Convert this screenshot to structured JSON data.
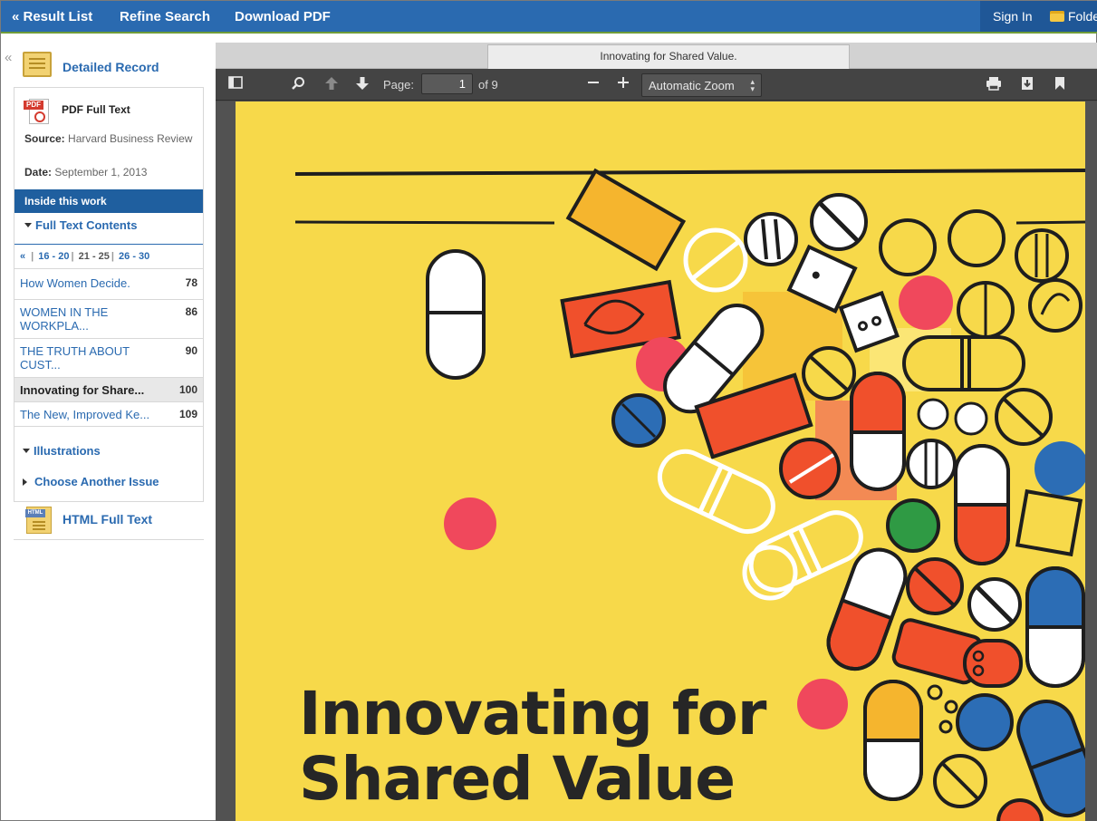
{
  "topbar": {
    "result_list": "« Result List",
    "refine_search": "Refine Search",
    "download_pdf": "Download PDF",
    "sign_in": "Sign In",
    "folder": "Folde"
  },
  "sidebar": {
    "collapse_glyph": "«",
    "detailed_record": "Detailed Record",
    "pdf_label": "PDF Full Text",
    "source_label": "Source:",
    "source_value": "Harvard Business Review",
    "date_label": "Date:",
    "date_value": "September 1, 2013",
    "inside_header": "Inside this work",
    "full_text_contents": "Full Text Contents",
    "pager": {
      "first": "«",
      "ranges": [
        "16 - 20",
        "21 - 25",
        "26 - 30"
      ]
    },
    "toc": [
      {
        "title": "How Women Decide.",
        "page": "78"
      },
      {
        "title": "WOMEN IN THE WORKPLA...",
        "page": "86"
      },
      {
        "title": "THE TRUTH ABOUT CUST...",
        "page": "90"
      },
      {
        "title": "Innovating for Share...",
        "page": "100"
      },
      {
        "title": "The New, Improved Ke...",
        "page": "109"
      }
    ],
    "illustrations": "Illustrations",
    "choose_issue": "Choose Another Issue",
    "html_full_text": "HTML Full Text",
    "icons": {
      "pdf_tag": "PDF",
      "html_tag": "HTML"
    }
  },
  "viewer": {
    "tab_title": "Innovating for Shared Value.",
    "page_label": "Page:",
    "page_value": "1",
    "page_total": "of 9",
    "zoom_value": "Automatic Zoom",
    "cover_line1": "Innovating for",
    "cover_line2": "Shared Value",
    "colors": {
      "cover_bg": "#f7d94a",
      "red": "#f0502c",
      "pink": "#f0485c",
      "blue": "#2c6db5",
      "green": "#2f9a44",
      "orange": "#f5a623"
    }
  }
}
